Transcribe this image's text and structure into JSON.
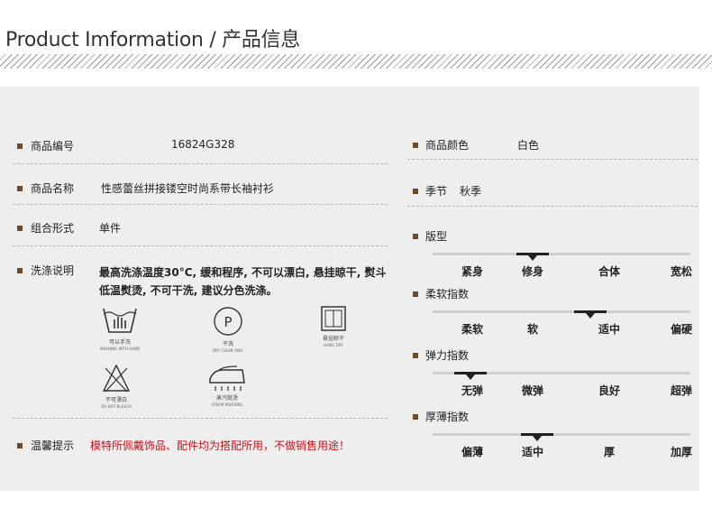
{
  "header": {
    "title": "Product Imformation / 产品信息"
  },
  "left": {
    "code": {
      "label": "商品编号",
      "value": "16824G328"
    },
    "name": {
      "label": "商品名称",
      "value": "性感蕾丝拼接镂空时尚系带长袖衬衫"
    },
    "combo": {
      "label": "组合形式",
      "value": "单件"
    },
    "wash": {
      "label": "洗涤说明",
      "text": "最高洗涤温度30°C, 缓和程序, 不可以漂白, 悬挂晾干, 熨斗低温熨烫, 不可干洗, 建议分色洗涤。",
      "icons": [
        {
          "icon": "hand-wash-icon",
          "cap": "可以手洗",
          "cap2": "WASHING WITH HAND"
        },
        {
          "icon": "dry-clean-icon",
          "cap": "干洗",
          "cap2": "DRY CLEAN ONLY",
          "letter": "P"
        },
        {
          "icon": "hang-dry-icon",
          "cap": "悬挂晾干",
          "cap2": "HANG DRY"
        },
        {
          "icon": "no-bleach-icon",
          "cap": "不可漂白",
          "cap2": "DO NOT BLEACH"
        },
        {
          "icon": "steam-iron-icon",
          "cap": "蒸汽熨烫",
          "cap2": "STEAM PRESSING"
        }
      ]
    },
    "tip": {
      "label": "温馨提示",
      "value": "模特所佩戴饰品、配件均为搭配所用，不做销售用途！"
    }
  },
  "right": {
    "color": {
      "label": "商品颜色",
      "value": "白色"
    },
    "season": {
      "label": "季节",
      "value": "秋季"
    },
    "scales": [
      {
        "label": "版型",
        "options": [
          "紧身",
          "修身",
          "合体",
          "宽松"
        ],
        "selected": 1
      },
      {
        "label": "柔软指数",
        "options": [
          "柔软",
          "软",
          "适中",
          "偏硬"
        ],
        "selected": 2
      },
      {
        "label": "弹力指数",
        "options": [
          "无弹",
          "微弹",
          "良好",
          "超弹"
        ],
        "selected": 0
      },
      {
        "label": "厚薄指数",
        "options": [
          "偏薄",
          "适中",
          "厚",
          "加厚"
        ],
        "selected": 1
      }
    ]
  },
  "colors": {
    "bullet": "#6b4a2e",
    "warning": "#c0141e",
    "panel": "#eeeeee"
  }
}
